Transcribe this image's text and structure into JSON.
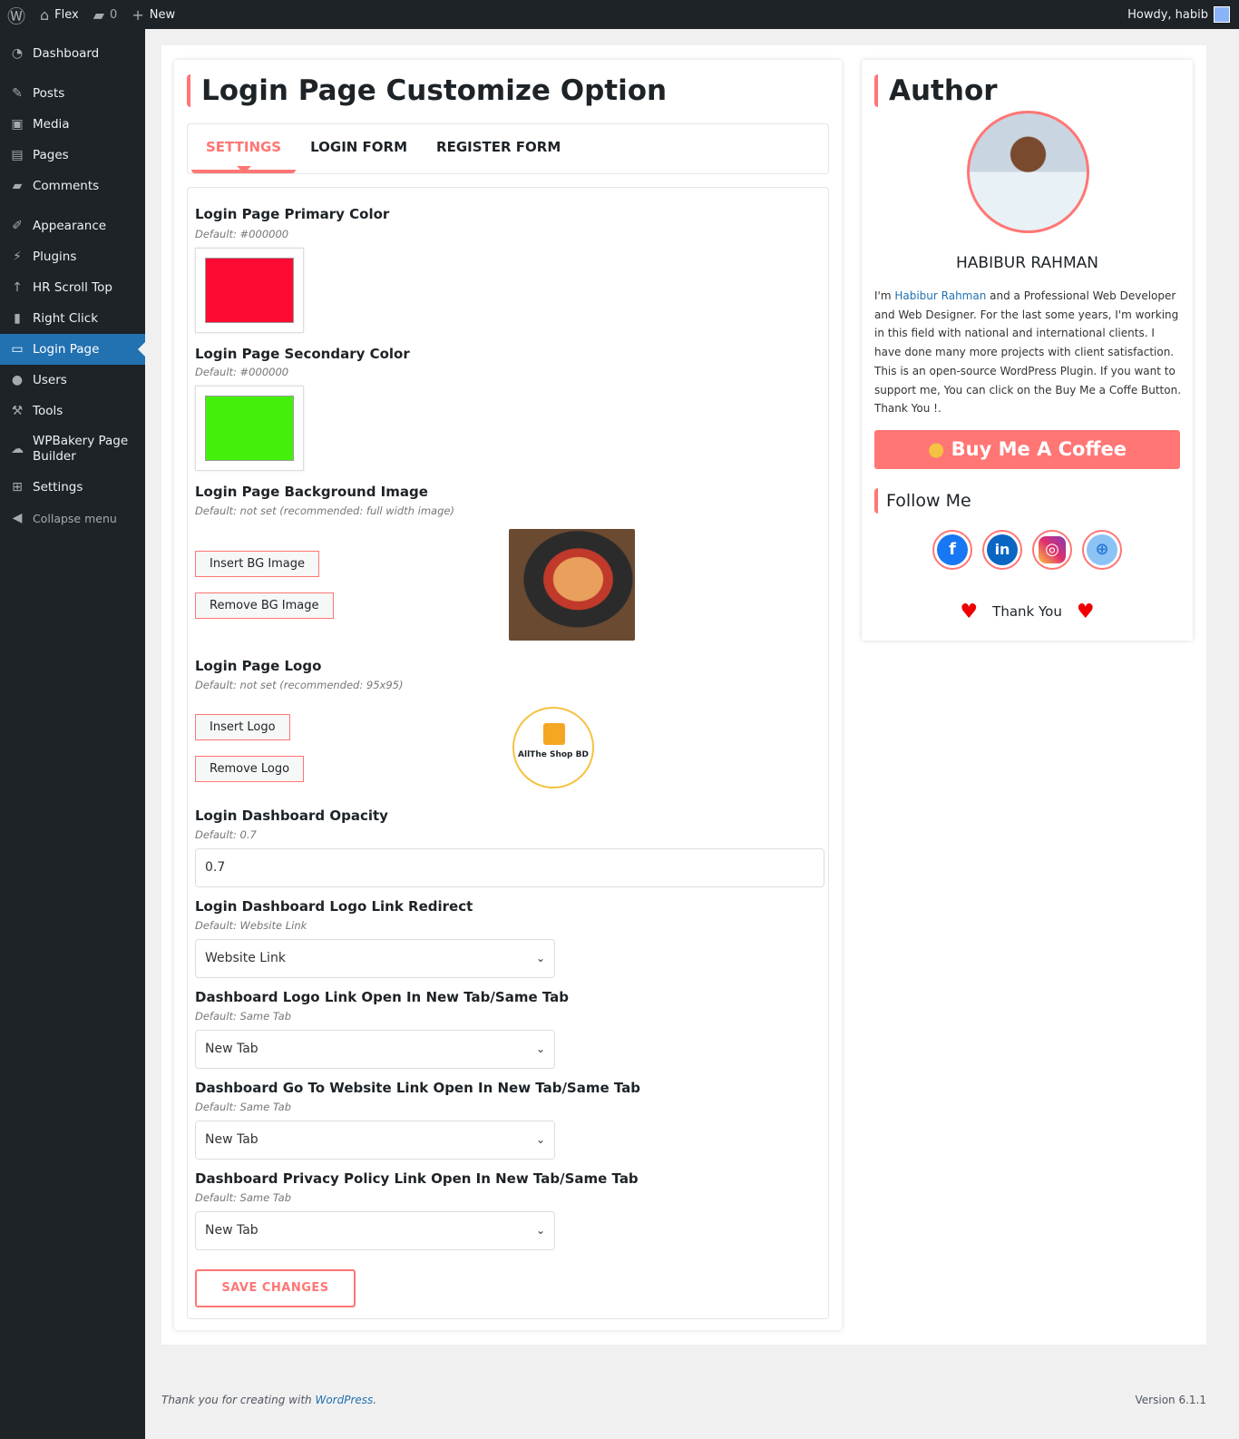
{
  "adminbar": {
    "site": "Flex",
    "comments": "0",
    "new": "New",
    "howdy": "Howdy, habib"
  },
  "sidebar": {
    "items": [
      {
        "label": "Dashboard",
        "icon": "dashboard-icon"
      },
      {
        "label": "Posts",
        "icon": "pin-icon"
      },
      {
        "label": "Media",
        "icon": "media-icon"
      },
      {
        "label": "Pages",
        "icon": "pages-icon"
      },
      {
        "label": "Comments",
        "icon": "comment-icon"
      },
      {
        "label": "Appearance",
        "icon": "brush-icon"
      },
      {
        "label": "Plugins",
        "icon": "plugin-icon"
      },
      {
        "label": "HR Scroll Top",
        "icon": "arrow-up-icon"
      },
      {
        "label": "Right Click",
        "icon": "mouse-icon"
      },
      {
        "label": "Login Page",
        "icon": "login-icon"
      },
      {
        "label": "Users",
        "icon": "user-icon"
      },
      {
        "label": "Tools",
        "icon": "wrench-icon"
      },
      {
        "label": "WPBakery Page Builder",
        "icon": "cloud-icon"
      },
      {
        "label": "Settings",
        "icon": "settings-icon"
      },
      {
        "label": "Collapse menu",
        "icon": "collapse-icon"
      }
    ]
  },
  "main": {
    "title": "Login Page Customize Option",
    "tabs": [
      "SETTINGS",
      "LOGIN FORM",
      "REGISTER FORM"
    ],
    "primary": {
      "label": "Login Page Primary Color",
      "default": "Default: #000000",
      "color": "#ff0a33"
    },
    "secondary": {
      "label": "Login Page Secondary Color",
      "default": "Default: #000000",
      "color": "#44f00a"
    },
    "bg": {
      "label": "Login Page Background Image",
      "default": "Default: not set (recommended: full width image)",
      "insert": "Insert BG Image",
      "remove": "Remove BG Image"
    },
    "logo": {
      "label": "Login Page Logo",
      "default": "Default: not set (recommended: 95x95)",
      "insert": "Insert Logo",
      "remove": "Remove Logo",
      "logo_text": "AllThe Shop BD"
    },
    "opacity": {
      "label": "Login Dashboard Opacity",
      "default": "Default: 0.7",
      "value": "0.7"
    },
    "redirect": {
      "label": "Login Dashboard Logo Link Redirect",
      "default": "Default: Website Link",
      "value": "Website Link"
    },
    "logo_tab": {
      "label": "Dashboard Logo Link Open In New Tab/Same Tab",
      "default": "Default: Same Tab",
      "value": "New Tab"
    },
    "website_tab": {
      "label": "Dashboard Go To Website Link Open In New Tab/Same Tab",
      "default": "Default: Same Tab",
      "value": "New Tab"
    },
    "privacy_tab": {
      "label": "Dashboard Privacy Policy Link Open In New Tab/Same Tab",
      "default": "Default: Same Tab",
      "value": "New Tab"
    },
    "save": "SAVE CHANGES"
  },
  "author": {
    "title": "Author",
    "name": "HABIBUR RAHMAN",
    "bio_prefix": "I'm ",
    "bio_link": "Habibur Rahman",
    "bio_rest": " and a Professional Web Developer and Web Designer. For the last some years, I'm working in this field with national and international clients. I have done many more projects with client satisfaction.",
    "bio2": "This is an open-source WordPress Plugin. If you want to support me, You can click on the Buy Me a Coffe Button. Thank You !.",
    "coffee": "Buy Me A Coffee",
    "follow": "Follow Me",
    "thanks": "Thank You"
  },
  "footer": {
    "text": "Thank you for creating with ",
    "link": "WordPress",
    "version": "Version 6.1.1"
  },
  "colors": {
    "accent": "#ff7675",
    "wp_blue": "#2271b1"
  }
}
